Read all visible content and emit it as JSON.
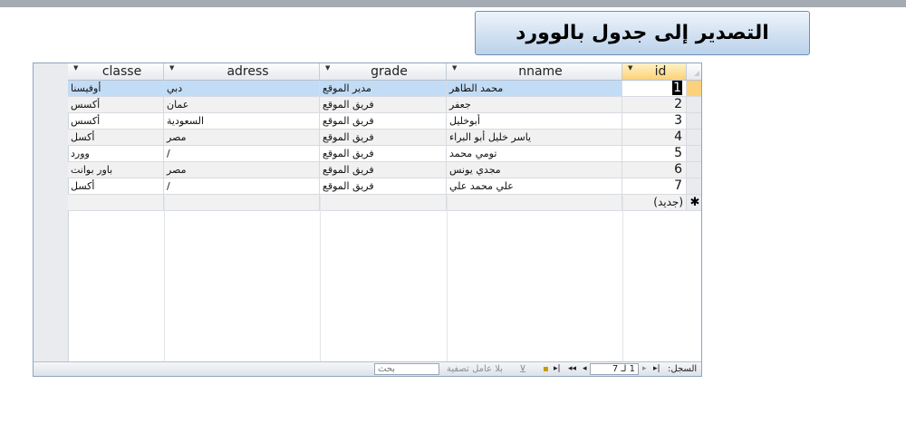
{
  "export_button": {
    "label": "التصدير إلى جدول بالوورد"
  },
  "columns": [
    {
      "key": "classe",
      "label": "classe"
    },
    {
      "key": "adress",
      "label": "adress"
    },
    {
      "key": "grade",
      "label": "grade"
    },
    {
      "key": "nname",
      "label": "nname"
    },
    {
      "key": "id",
      "label": "id"
    }
  ],
  "rows": [
    {
      "id": "1",
      "nname": "محمد الطاهر",
      "grade": "مدير الموقع",
      "adress": "دبي",
      "classe": "أوفيسنا"
    },
    {
      "id": "2",
      "nname": "جعفر",
      "grade": "فريق الموقع",
      "adress": "عمان",
      "classe": "أكسس"
    },
    {
      "id": "3",
      "nname": "أبوخليل",
      "grade": "فريق الموقع",
      "adress": "السعودية",
      "classe": "أكسس"
    },
    {
      "id": "4",
      "nname": "ياسر خليل أبو البراء",
      "grade": "فريق الموقع",
      "adress": "مصر",
      "classe": "أكسل"
    },
    {
      "id": "5",
      "nname": "تومي محمد",
      "grade": "فريق الموقع",
      "adress": "/",
      "classe": "وورد"
    },
    {
      "id": "6",
      "nname": "مجدي يونس",
      "grade": "فريق الموقع",
      "adress": "مصر",
      "classe": "باور بوانت"
    },
    {
      "id": "7",
      "nname": "علي محمد علي",
      "grade": "فريق الموقع",
      "adress": "/",
      "classe": "أكسل"
    }
  ],
  "new_row": {
    "marker": "✱",
    "label": "(جديد)"
  },
  "status_bar": {
    "record_label": "السجل:",
    "record_position": "1 لـ 7",
    "no_filter": "بلا عامل تصفية",
    "search_label": "بحث",
    "search_value": ""
  },
  "icons": {
    "first": "first-record-icon",
    "prev": "previous-record-icon",
    "next": "next-record-icon",
    "last": "last-record-icon",
    "new": "new-record-icon",
    "filter": "no-filter-icon"
  }
}
